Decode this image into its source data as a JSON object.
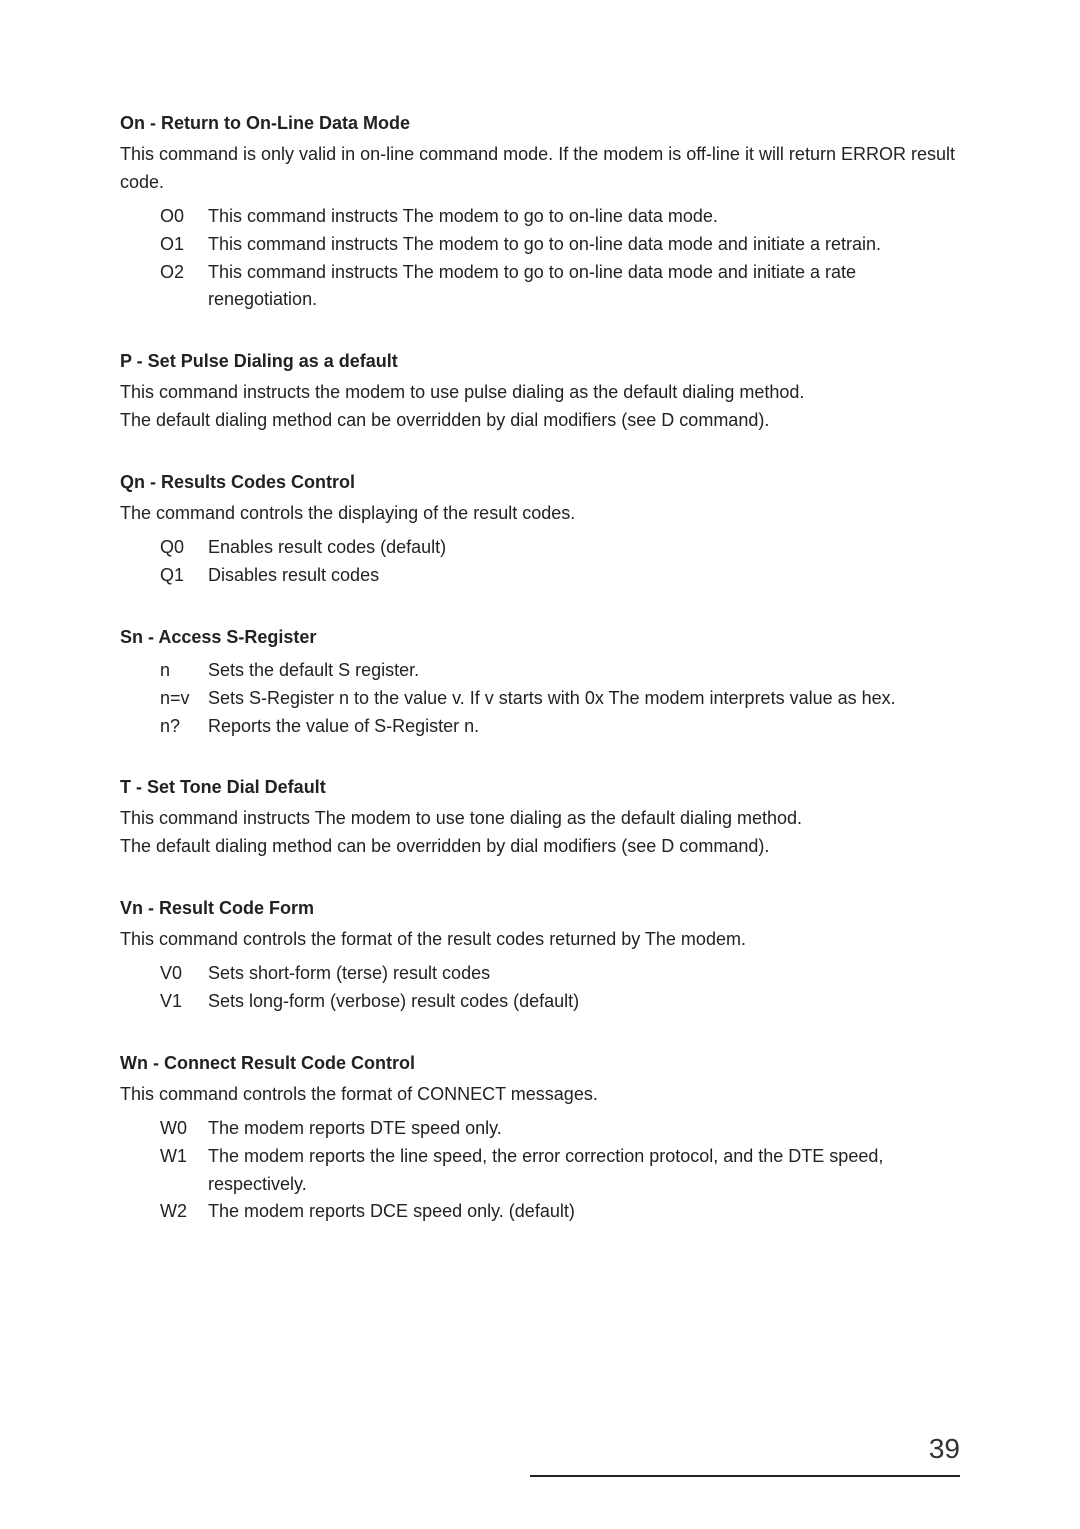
{
  "sections": [
    {
      "heading": "On - Return to On-Line Data Mode",
      "paragraphs": [
        "This command is only valid in on-line command mode. If the modem is off-line it will return ERROR result code."
      ],
      "items": [
        {
          "code": "O0",
          "text": "This command instructs The modem to go to on-line data mode."
        },
        {
          "code": "O1",
          "text": "This command instructs The modem to go to on-line data mode and initiate a retrain."
        },
        {
          "code": "O2",
          "text": "This command instructs The modem to go to on-line data mode and initiate a rate renegotiation."
        }
      ]
    },
    {
      "heading": "P - Set Pulse Dialing as a default",
      "paragraphs": [
        "This command instructs the modem to use pulse dialing as the default dialing method.",
        "The default dialing method can be overridden by dial modifiers (see D command)."
      ],
      "items": []
    },
    {
      "heading": "Qn - Results Codes Control",
      "paragraphs": [
        "The command controls the displaying of the result codes."
      ],
      "items": [
        {
          "code": "Q0",
          "text": "Enables result codes (default)"
        },
        {
          "code": "Q1",
          "text": "Disables result codes"
        }
      ]
    },
    {
      "heading": "Sn - Access S-Register",
      "paragraphs": [],
      "items": [
        {
          "code": "n",
          "text": "Sets the default S register."
        },
        {
          "code": "n=v",
          "text": "Sets S-Register n to the value v. If v starts with 0x The modem interprets value as hex."
        },
        {
          "code": "n?",
          "text": "Reports the value of S-Register n."
        }
      ]
    },
    {
      "heading": "T - Set Tone Dial Default",
      "paragraphs": [
        "This command instructs The modem to use tone dialing as the default dialing method.",
        "The default dialing method can be overridden by dial modifiers (see D command)."
      ],
      "items": []
    },
    {
      "heading": "Vn - Result Code Form",
      "paragraphs": [
        "This command controls the format of the result codes returned by The modem."
      ],
      "items": [
        {
          "code": "V0",
          "text": "Sets short-form (terse) result codes"
        },
        {
          "code": "V1",
          "text": "Sets long-form (verbose) result codes (default)"
        }
      ]
    },
    {
      "heading": "Wn - Connect Result Code Control",
      "paragraphs": [
        "This command controls the format of CONNECT messages."
      ],
      "items": [
        {
          "code": "W0",
          "text": "The modem reports DTE speed only."
        },
        {
          "code": "W1",
          "text": "The modem reports the line speed, the error correction protocol, and the DTE speed, respectively."
        },
        {
          "code": "W2",
          "text": "The modem reports DCE speed only. (default)"
        }
      ]
    }
  ],
  "page_number": "39"
}
